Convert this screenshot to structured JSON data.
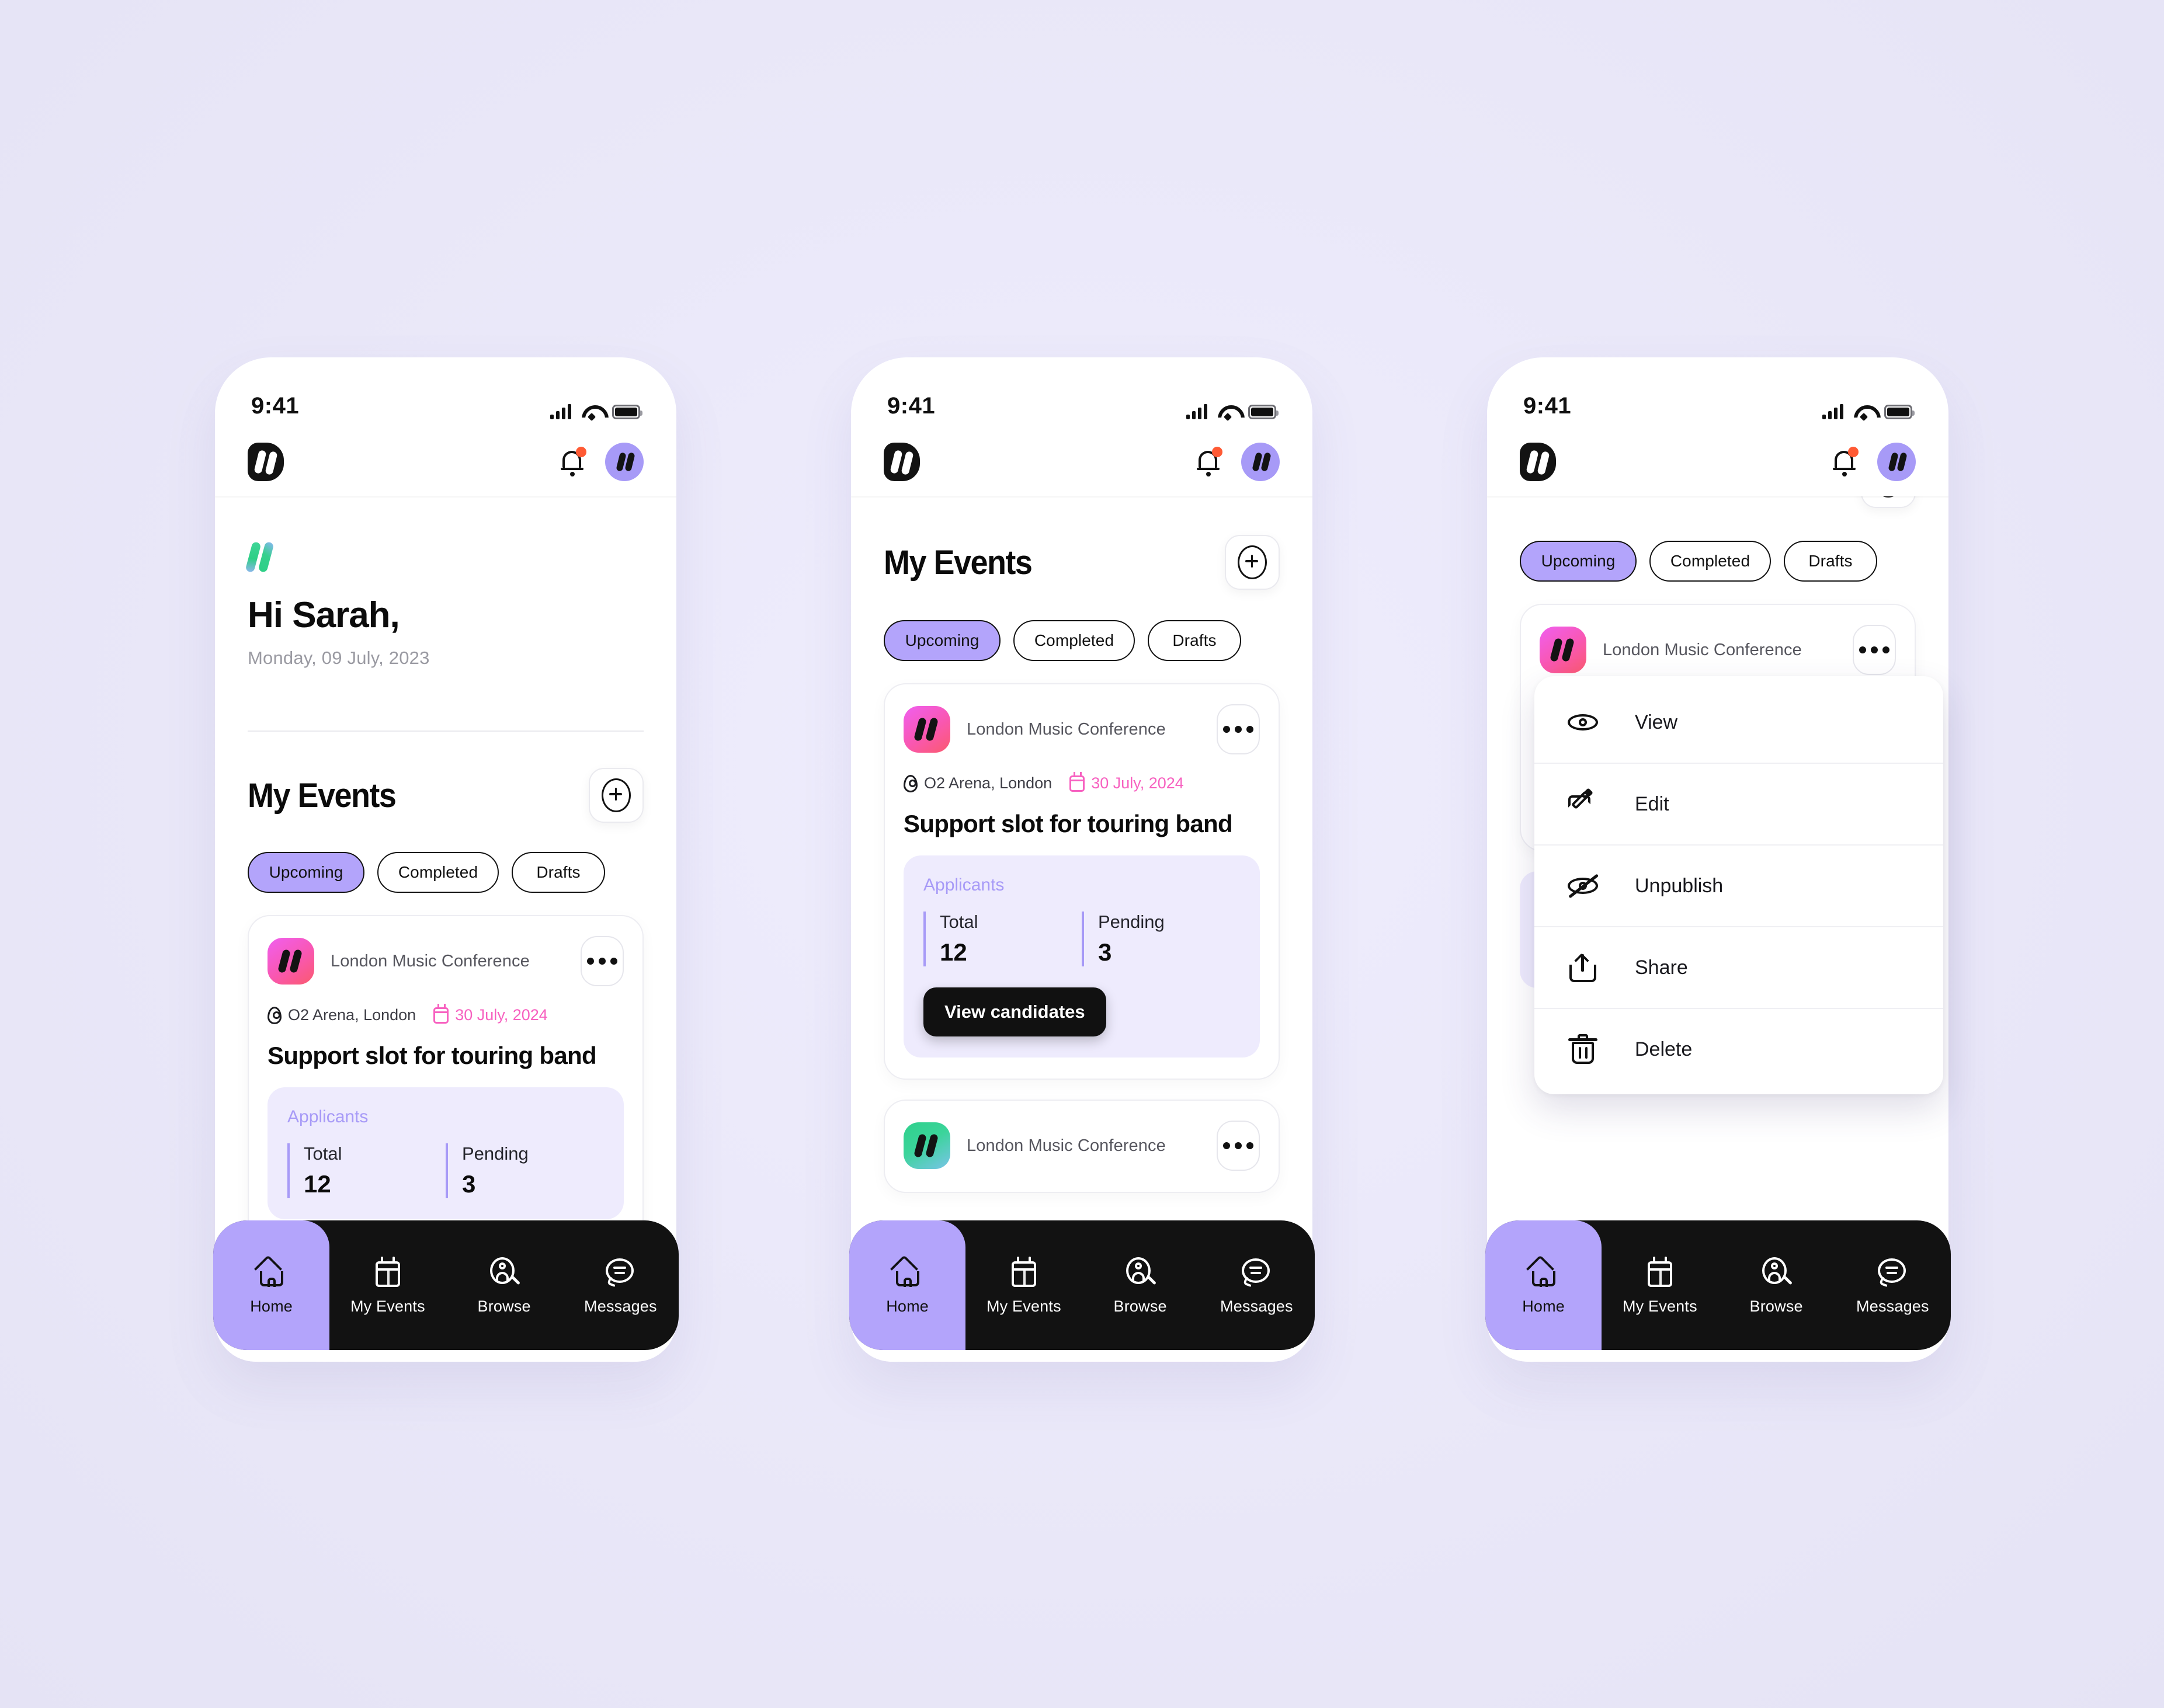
{
  "status_bar": {
    "time": "9:41"
  },
  "app_header": {
    "logo_name": "brand-logo",
    "notification_badge": true
  },
  "colors": {
    "background": "#ebe9fb",
    "accent_purple": "#b3a4fb",
    "avatar_purple": "#a79af7",
    "applicants_panel": "#eeebfd",
    "date_pink": "#f761c0",
    "nav_black": "#121212",
    "badge_orange": "#ff5a34"
  },
  "screen_home": {
    "greeting": "Hi Sarah,",
    "date": "Monday, 09 July, 2023",
    "section_title": "My Events",
    "add_button_label": "+",
    "tabs": [
      {
        "label": "Upcoming",
        "active": true
      },
      {
        "label": "Completed",
        "active": false
      },
      {
        "label": "Drafts",
        "active": false
      }
    ],
    "event": {
      "organiser": "London Music Conference",
      "location": "O2 Arena, London",
      "date": "30 July, 2024",
      "title": "Support slot for touring band",
      "applicants_label": "Applicants",
      "stats": [
        {
          "key": "Total",
          "value": "12"
        },
        {
          "key": "Pending",
          "value": "3"
        }
      ]
    }
  },
  "screen_events": {
    "section_title": "My Events",
    "tabs": [
      {
        "label": "Upcoming",
        "active": true
      },
      {
        "label": "Completed",
        "active": false
      },
      {
        "label": "Drafts",
        "active": false
      }
    ],
    "event": {
      "organiser": "London Music Conference",
      "location": "O2 Arena, London",
      "date": "30 July, 2024",
      "title": "Support slot for touring band",
      "applicants_label": "Applicants",
      "stats": [
        {
          "key": "Total",
          "value": "12"
        },
        {
          "key": "Pending",
          "value": "3"
        }
      ],
      "cta": "View candidates"
    },
    "event_2": {
      "organiser": "London Music Conference"
    }
  },
  "screen_menu": {
    "tabs": [
      {
        "label": "Upcoming",
        "active": true
      },
      {
        "label": "Completed",
        "active": false
      },
      {
        "label": "Drafts",
        "active": false
      }
    ],
    "event": {
      "organiser": "London Music Conference"
    },
    "menu_items": [
      {
        "label": "View",
        "icon": "eye-icon"
      },
      {
        "label": "Edit",
        "icon": "pencil-icon"
      },
      {
        "label": "Unpublish",
        "icon": "eye-off-icon"
      },
      {
        "label": "Share",
        "icon": "share-icon"
      },
      {
        "label": "Delete",
        "icon": "trash-icon"
      }
    ]
  },
  "bottom_nav": {
    "items": [
      {
        "label": "Home",
        "icon": "home-icon",
        "active": true
      },
      {
        "label": "My Events",
        "icon": "calendar-icon",
        "active": false
      },
      {
        "label": "Browse",
        "icon": "person-search-icon",
        "active": false
      },
      {
        "label": "Messages",
        "icon": "chat-bubble-icon",
        "active": false
      }
    ]
  }
}
